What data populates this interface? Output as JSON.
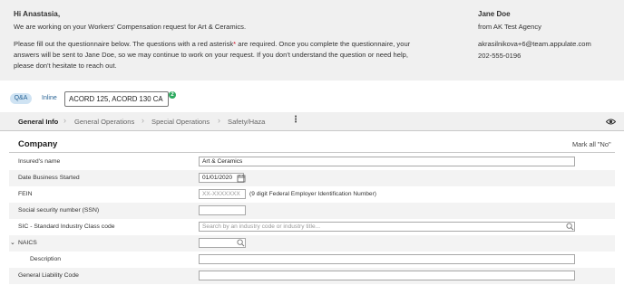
{
  "header": {
    "greeting": "Hi Anastasia,",
    "line1": "We are working on your Workers' Compensation request for Art & Ceramics.",
    "line2a": "Please fill out the questionnaire below. The questions with a red asterisk",
    "line2b": "* are required. Once you complete the questionnaire, your",
    "line3": "answers will be sent to Jane Doe, so we may continue to work on your request. If you don't understand the question or need help,",
    "line4": "please don't hesitate to reach out."
  },
  "contact": {
    "name": "Jane Doe",
    "agency": "from AK Test Agency",
    "email": "akrasilnikova+6@team.appulate.com",
    "phone": "202-555-0196"
  },
  "toolbar": {
    "qa_label": "Q&A",
    "inline_label": "Inline",
    "form_select_value": "ACORD 125, ACORD 130 CA",
    "badge_count": "2"
  },
  "tabs": [
    {
      "label": "General Info"
    },
    {
      "label": "General Operations"
    },
    {
      "label": "Special Operations"
    },
    {
      "label": "Safety/Haza"
    }
  ],
  "section": {
    "title": "Company",
    "mark_all": "Mark all \"No\""
  },
  "rows": {
    "insured_name": {
      "label": "Insured's name",
      "value": "Art & Ceramics"
    },
    "date_started": {
      "label": "Date Business Started",
      "value": "01/01/2020"
    },
    "fein": {
      "label": "FEIN",
      "placeholder": "XX-XXXXXXX",
      "hint": "(9 digit Federal Employer Identification Number)"
    },
    "ssn": {
      "label": "Social security number (SSN)"
    },
    "sic": {
      "label": "SIC - Standard Industry Class code",
      "placeholder": "Search by an industry code or industry title..."
    },
    "naics": {
      "label": "NAICS"
    },
    "description": {
      "label": "Description"
    },
    "gl_code": {
      "label": "General Liability Code"
    }
  },
  "icons": {
    "chevron": "chevron-down-icon",
    "check": "check-badge-icon",
    "eye": "eye-icon",
    "kebab": "kebab-menu-icon",
    "search": "search-icon",
    "calendar": "calendar-icon"
  },
  "colors": {
    "link": "#2a6496",
    "required": "#d0021b",
    "badge": "#2eaa5f",
    "banner_bg": "#f0f0f0"
  }
}
